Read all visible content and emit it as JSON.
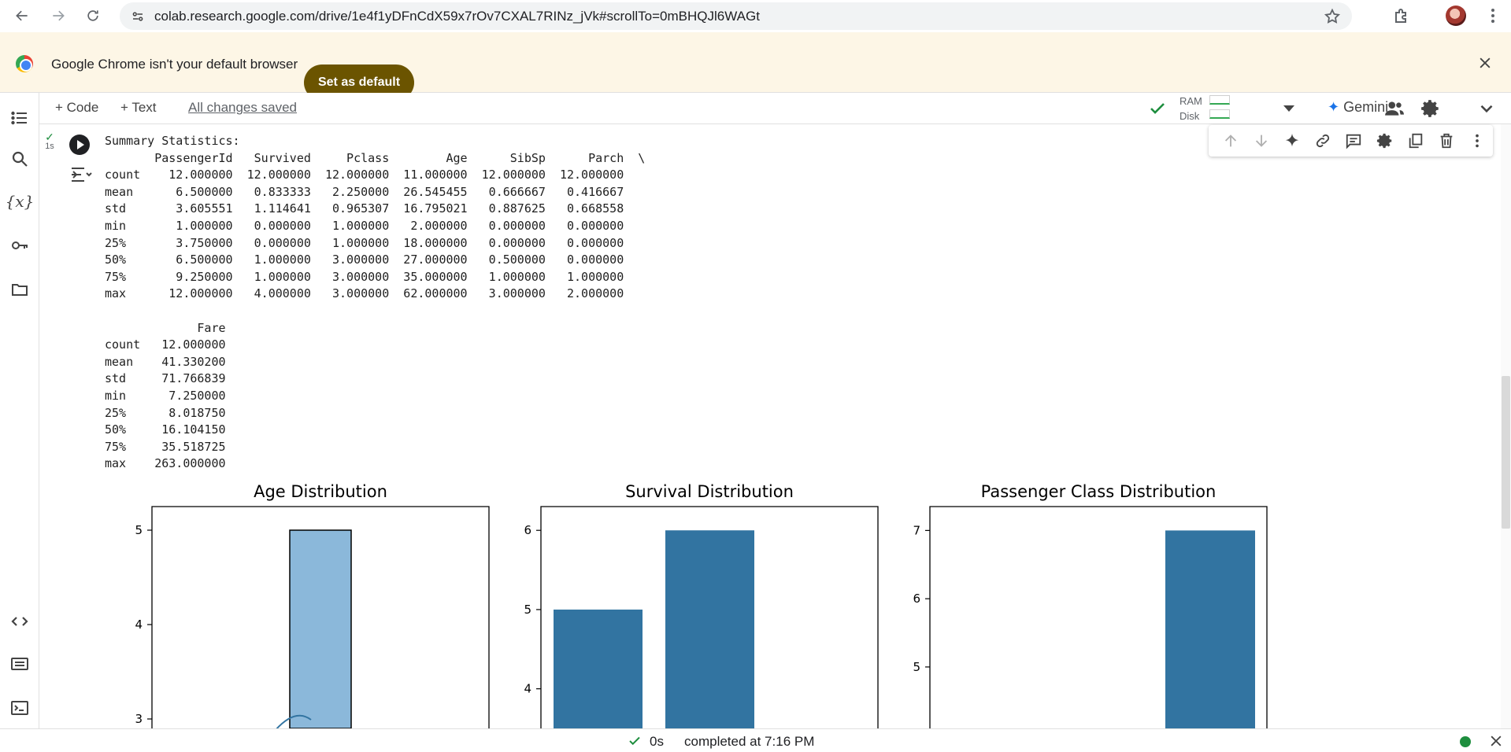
{
  "browser": {
    "url": "colab.research.google.com/drive/1e4f1yDFnCdX59x7rOv7CXAL7RINz_jVk#scrollTo=0mBHQJl6WAGt"
  },
  "infobar": {
    "message": "Google Chrome isn't your default browser",
    "button": "Set as default"
  },
  "toolbar": {
    "add_code": "+ Code",
    "add_text": "+ Text",
    "saved_status": "All changes saved",
    "ram_label": "RAM",
    "disk_label": "Disk",
    "gemini_label": "Gemini"
  },
  "cell": {
    "exec_time": "1s",
    "output_lines": [
      "Summary Statistics:",
      "       PassengerId   Survived     Pclass        Age      SibSp      Parch  \\",
      "count    12.000000  12.000000  12.000000  11.000000  12.000000  12.000000",
      "mean      6.500000   0.833333   2.250000  26.545455   0.666667   0.416667",
      "std       3.605551   1.114641   0.965307  16.795021   0.887625   0.668558",
      "min       1.000000   0.000000   1.000000   2.000000   0.000000   0.000000",
      "25%       3.750000   0.000000   1.000000  18.000000   0.000000   0.000000",
      "50%       6.500000   1.000000   3.000000  27.000000   0.500000   0.000000",
      "75%       9.250000   1.000000   3.000000  35.000000   1.000000   1.000000",
      "max      12.000000   4.000000   3.000000  62.000000   3.000000   2.000000",
      "",
      "             Fare",
      "count   12.000000",
      "mean    41.330200",
      "std     71.766839",
      "min      7.250000",
      "25%      8.018750",
      "50%     16.104150",
      "75%     35.518725",
      "max    263.000000"
    ]
  },
  "chart_data": [
    {
      "type": "bar",
      "title": "Age Distribution",
      "yticks": [
        3,
        4,
        5
      ],
      "visible_ylim": [
        2.9,
        5.25
      ],
      "bars": [
        {
          "value": 5
        }
      ],
      "kde": true,
      "color": "#8bb8da"
    },
    {
      "type": "bar",
      "title": "Survival Distribution",
      "yticks": [
        4,
        5,
        6
      ],
      "visible_ylim": [
        3.5,
        6.3
      ],
      "values": [
        5,
        6
      ],
      "color": "#3274a1"
    },
    {
      "type": "bar",
      "title": "Passenger Class Distribution",
      "yticks": [
        5,
        6,
        7
      ],
      "visible_ylim": [
        4.1,
        7.35
      ],
      "values": [
        7
      ],
      "color": "#3274a1"
    }
  ],
  "status": {
    "elapsed": "0s",
    "completed": "completed at 7:16 PM"
  }
}
